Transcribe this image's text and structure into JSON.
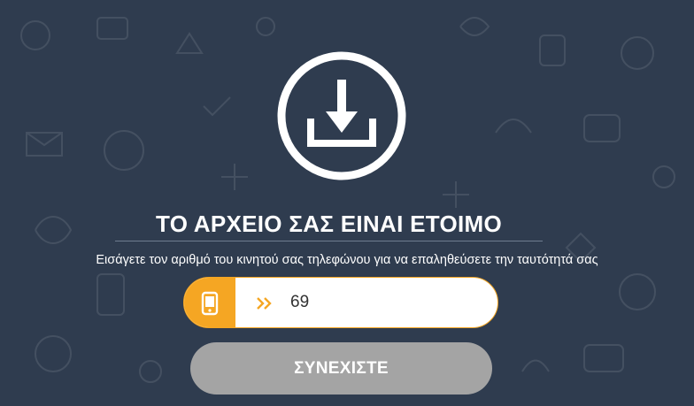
{
  "hero": {
    "icon": "download-icon",
    "title": "ΤΟ ΑΡΧΕΙΟ ΣΑΣ ΕΙΝΑΙ ΕΤΟΙΜΟ",
    "subtitle": "Εισάγετε τον αριθμό του κινητού σας τηλεφώνου για να επαληθεύσετε την ταυτότητά σας"
  },
  "phone_field": {
    "icon": "mobile-phone-icon",
    "prefix_icon": "double-chevron-right-icon",
    "value": "69"
  },
  "continue_button": {
    "label": "ΣΥΝΕΧΙΣΤΕ"
  },
  "colors": {
    "background": "#2f3c4f",
    "accent": "#f5a623",
    "button_disabled": "#a4a4a4",
    "text": "#ffffff"
  }
}
